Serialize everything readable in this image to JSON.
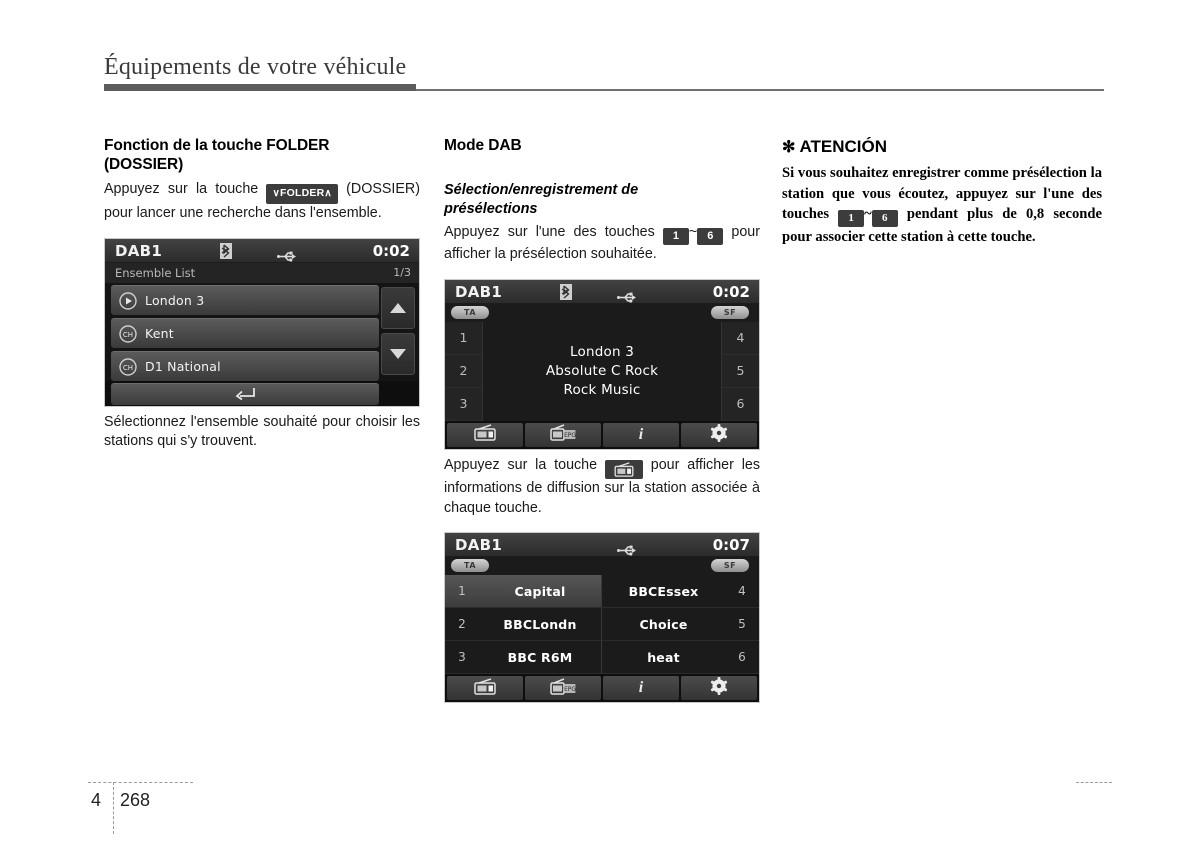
{
  "header": {
    "title": "Équipements de votre véhicule"
  },
  "left_column": {
    "section_title_line1": "Fonction de la touche FOLDER",
    "section_title_line2": "(DOSSIER)",
    "paragraph_before_chip": "Appuyez sur la touche",
    "folder_chip_label": "FOLDER",
    "paragraph_after_chip": "(DOSSIER) pour lancer une recherche dans l'ensemble.",
    "caption": "Sélectionnez l'ensemble souhaité pour choisir les stations qui s'y trouvent."
  },
  "ensemble_screen": {
    "source": "DAB1",
    "bluetooth_icon": "bluetooth-icon",
    "usb_icon": "usb-icon",
    "clock": "0:02",
    "list_title": "Ensemble List",
    "page_indicator": "1/3",
    "rows": [
      {
        "icon": "play-icon",
        "label": "London 3"
      },
      {
        "icon": "ch-icon",
        "label": "Kent"
      },
      {
        "icon": "ch-icon",
        "label": "D1 National"
      }
    ],
    "scroll_up_icon": "arrow-up-icon",
    "scroll_down_icon": "arrow-down-icon",
    "back_icon": "back-arrow-icon"
  },
  "mid_column": {
    "section_title": "Mode DAB",
    "sub_title_line1": "Sélection/enregistrement de",
    "sub_title_line2": "présélections",
    "paragraph_part1": "Appuyez sur l'une des touches",
    "chip_first": "1",
    "chip_tilde": "~",
    "chip_last": "6",
    "paragraph_part2": "pour afficher la présélection souhaitée.",
    "paragraph2_part1": "Appuyez sur la touche",
    "paragraph2_chip_icon": "radio-icon",
    "paragraph2_part2": "pour afficher les informations de diffusion sur la station associée à chaque touche."
  },
  "now_playing_screen": {
    "source": "DAB1",
    "bluetooth_icon": "bluetooth-icon",
    "usb_icon": "usb-icon",
    "clock": "0:02",
    "badge_ta": "TA",
    "badge_sf": "SF",
    "left_numbers": [
      "1",
      "2",
      "3"
    ],
    "right_numbers": [
      "4",
      "5",
      "6"
    ],
    "lines": [
      "London 3",
      "Absolute C Rock",
      "Rock Music"
    ],
    "toolbar": [
      {
        "icon": "radio-icon",
        "label": ""
      },
      {
        "icon": "radio-epg-icon",
        "label": "EPG"
      },
      {
        "icon": "info-icon",
        "label": "i"
      },
      {
        "icon": "gear-icon",
        "label": ""
      }
    ]
  },
  "presets_screen": {
    "source": "DAB1",
    "usb_icon": "usb-icon",
    "clock": "0:07",
    "badge_ta": "TA",
    "badge_sf": "SF",
    "presets_left": [
      {
        "num": "1",
        "name": "Capital",
        "active": true
      },
      {
        "num": "2",
        "name": "BBCLondn",
        "active": false
      },
      {
        "num": "3",
        "name": "BBC R6M",
        "active": false
      }
    ],
    "presets_right": [
      {
        "num": "4",
        "name": "BBCEssex",
        "active": false
      },
      {
        "num": "5",
        "name": "Choice",
        "active": false
      },
      {
        "num": "6",
        "name": "heat",
        "active": false
      }
    ],
    "toolbar": [
      {
        "icon": "radio-icon",
        "label": ""
      },
      {
        "icon": "radio-epg-icon",
        "label": "EPG"
      },
      {
        "icon": "info-icon",
        "label": "i"
      },
      {
        "icon": "gear-icon",
        "label": ""
      }
    ]
  },
  "caution": {
    "star": "✻",
    "title": "ATENCIÓN",
    "text_part1": "Si vous souhaitez enregistrer comme présélection la station que vous écoutez, appuyez sur l'une des touches",
    "chip_first": "1",
    "chip_tilde": "~",
    "chip_last": "6",
    "text_part2": "pendant plus de 0,8 seconde pour associer cette station à cette touche."
  },
  "footer": {
    "chapter": "4",
    "page": "268"
  }
}
